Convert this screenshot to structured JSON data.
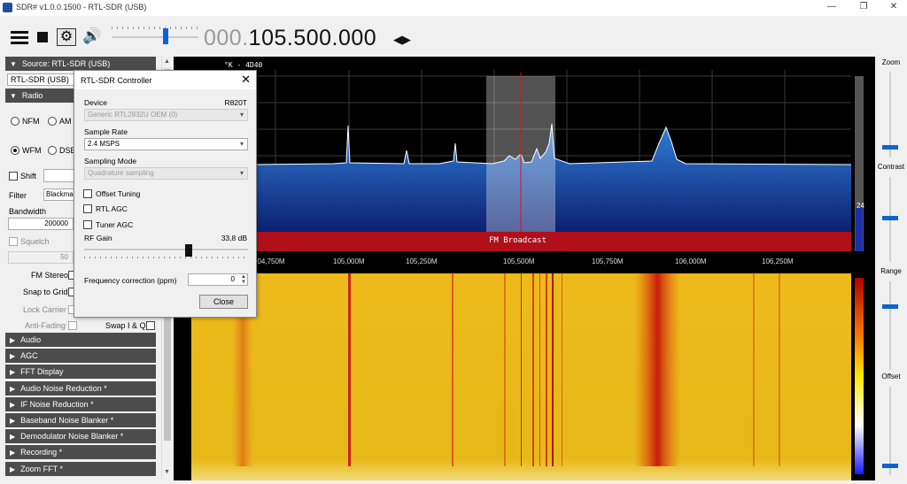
{
  "window": {
    "title": "SDR# v1.0.0.1500 - RTL-SDR (USB)",
    "controls": [
      "—",
      "❐",
      "✕"
    ]
  },
  "toolbar": {
    "frequency_prefix": "000.",
    "frequency_main": "105.500.000",
    "frequency_step_arrows": "◀▶",
    "volume_level": 0.62
  },
  "left_panel": {
    "source_header": "Source: RTL-SDR (USB)",
    "source_value": "RTL-SDR (USB)",
    "radio_header": "Radio",
    "modes": [
      "NFM",
      "AM",
      "WFM",
      "DSB"
    ],
    "selected_mode": "WFM",
    "shift_label": "Shift",
    "filter_label": "Filter",
    "filter_value": "Blackman",
    "bandwidth_label": "Bandwidth",
    "bandwidth_value": "200000",
    "squelch_label": "Squelch",
    "squelch_value": "50",
    "fm_stereo_label": "FM Stereo",
    "snap_to_grid_label": "Snap to Grid",
    "lock_carrier_label": "Lock Carrier",
    "anti_fading_label": "Anti-Fading",
    "swap_iq_label": "Swap I & Q",
    "plugins": [
      "Audio",
      "AGC",
      "FFT Display",
      "Audio Noise Reduction *",
      "IF Noise Reduction *",
      "Baseband Noise Blanker *",
      "Demodulator Noise Blanker *",
      "Recording *",
      "Zoom FFT *"
    ]
  },
  "spectrum": {
    "corner_label": "°K - 4D40",
    "band_label": "FM Broadcast",
    "freq_ticks": [
      "104,750M",
      "105,000M",
      "105,250M",
      "105,500M",
      "105,750M",
      "106,000M",
      "106,250M"
    ],
    "level_value": "24"
  },
  "right_panel": {
    "zoom_label": "Zoom",
    "contrast_label": "Contrast",
    "range_label": "Range",
    "offset_label": "Offset"
  },
  "dialog": {
    "title": "RTL-SDR Controller",
    "close_icon": "✕",
    "device_label": "Device",
    "device_tuner": "R820T",
    "device_value": "Generic RTL2832U OEM (0)",
    "sample_rate_label": "Sample Rate",
    "sample_rate_value": "2.4 MSPS",
    "sampling_mode_label": "Sampling Mode",
    "sampling_mode_value": "Quadrature sampling",
    "offset_tuning_label": "Offset Tuning",
    "rtl_agc_label": "RTL AGC",
    "tuner_agc_label": "Tuner AGC",
    "rf_gain_label": "RF Gain",
    "rf_gain_value": "33,8 dB",
    "freq_correction_label": "Frequency correction (ppm)",
    "freq_correction_value": "0",
    "close_button": "Close"
  }
}
